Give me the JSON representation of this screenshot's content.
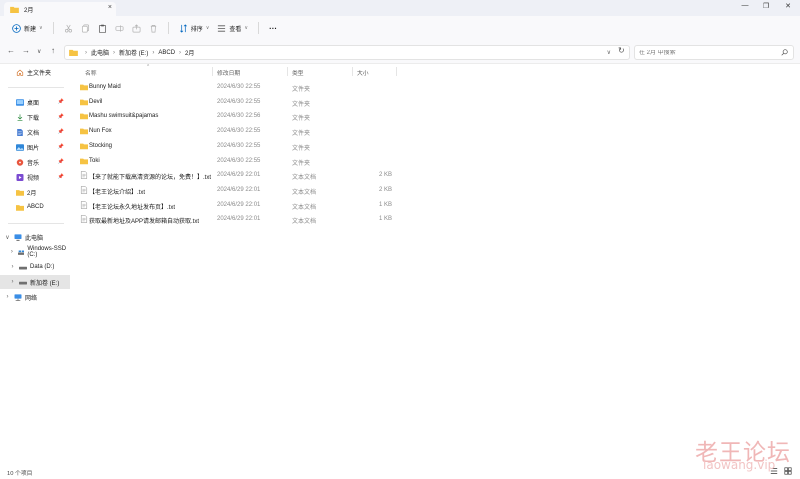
{
  "tabbar": {
    "active_tab_title": "2月",
    "new_tab_label": "+",
    "close_label": "×",
    "window_controls": [
      "—",
      "❐",
      "✕"
    ]
  },
  "toolbar": {
    "new_label": "新建",
    "sort_label": "排序",
    "view_label": "查看",
    "more_label": "···",
    "icons": [
      "new-icon",
      "cut-icon",
      "copy-icon",
      "paste-icon",
      "rename-icon",
      "share-icon",
      "delete-icon",
      "sort-icon",
      "view-icon",
      "more-icon"
    ]
  },
  "nav": {
    "back": "←",
    "forward": "→",
    "recent": "∨",
    "up": "↑",
    "breadcrumbs": [
      "此电脑",
      "新加卷 (E:)",
      "ABCD",
      "2月"
    ],
    "address_dropdown": "∨",
    "refresh": "↻",
    "search_placeholder": "在 2月 中搜索"
  },
  "sidebar": {
    "home": "主文件夹",
    "quick_access": [
      {
        "label": "桌面",
        "icon": "desktop-icon",
        "pinned": true
      },
      {
        "label": "下载",
        "icon": "download-icon",
        "pinned": true
      },
      {
        "label": "文档",
        "icon": "document-icon",
        "pinned": true
      },
      {
        "label": "图片",
        "icon": "picture-icon",
        "pinned": true
      },
      {
        "label": "音乐",
        "icon": "music-icon",
        "pinned": true
      },
      {
        "label": "视频",
        "icon": "video-icon",
        "pinned": true
      },
      {
        "label": "2月",
        "icon": "folder-icon",
        "pinned": false
      },
      {
        "label": "ABCD",
        "icon": "folder-icon",
        "pinned": false
      }
    ],
    "this_pc": "此电脑",
    "drives": [
      {
        "label": "Windows-SSD (C:)",
        "icon": "drive-c-icon"
      },
      {
        "label": "Data (D:)",
        "icon": "drive-icon"
      },
      {
        "label": "新加卷 (E:)",
        "icon": "drive-icon"
      }
    ],
    "network": "网络"
  },
  "columns": {
    "name": "名称",
    "date": "修改日期",
    "type": "类型",
    "size": "大小"
  },
  "files": [
    {
      "name": "Bunny Maid",
      "date": "2024/6/30 22:55",
      "type": "文件夹",
      "size": "",
      "kind": "folder"
    },
    {
      "name": "Devil",
      "date": "2024/6/30 22:55",
      "type": "文件夹",
      "size": "",
      "kind": "folder"
    },
    {
      "name": "Mashu swimsuit&pajamas",
      "date": "2024/6/30 22:56",
      "type": "文件夹",
      "size": "",
      "kind": "folder"
    },
    {
      "name": "Nun Fox",
      "date": "2024/6/30 22:55",
      "type": "文件夹",
      "size": "",
      "kind": "folder"
    },
    {
      "name": "Stocking",
      "date": "2024/6/30 22:55",
      "type": "文件夹",
      "size": "",
      "kind": "folder"
    },
    {
      "name": "Toki",
      "date": "2024/6/30 22:55",
      "type": "文件夹",
      "size": "",
      "kind": "folder"
    },
    {
      "name": "【来了就能下载高清资源的论坛，免费！】.txt",
      "date": "2024/6/29 22:01",
      "type": "文本文档",
      "size": "2 KB",
      "kind": "txt"
    },
    {
      "name": "【老王论坛介绍】.txt",
      "date": "2024/6/29 22:01",
      "type": "文本文档",
      "size": "2 KB",
      "kind": "txt"
    },
    {
      "name": "【老王论坛永久地址发布页】.txt",
      "date": "2024/6/29 22:01",
      "type": "文本文档",
      "size": "1 KB",
      "kind": "txt"
    },
    {
      "name": "获取最新地址及APP请发邮箱自动获取.txt",
      "date": "2024/6/29 22:01",
      "type": "文本文档",
      "size": "1 KB",
      "kind": "txt"
    }
  ],
  "status": {
    "item_count": "10 个项目"
  },
  "watermark": {
    "cn": "老王论坛",
    "en": "laowang.vip"
  },
  "colors": {
    "folder": "#f6c343",
    "accent": "#0067c0",
    "selected": "#e5e5e5"
  }
}
